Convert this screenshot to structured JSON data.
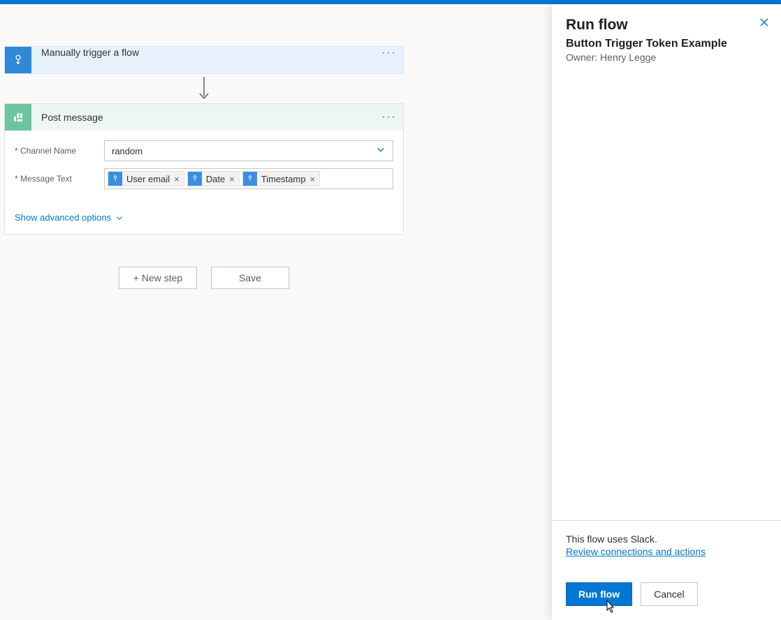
{
  "canvas": {
    "trigger": {
      "title": "Manually trigger a flow"
    },
    "action": {
      "title": "Post message",
      "fields": {
        "channel_label": "* Channel Name",
        "channel_value": "random",
        "message_label": "* Message Text",
        "tokens": [
          {
            "label": "User email"
          },
          {
            "label": "Date"
          },
          {
            "label": "Timestamp"
          }
        ]
      },
      "advanced_label": "Show advanced options"
    },
    "buttons": {
      "new_step": "+ New step",
      "save": "Save"
    }
  },
  "panel": {
    "title": "Run flow",
    "subtitle": "Button Trigger Token Example",
    "owner": "Owner: Henry Legge",
    "footer_text": "This flow uses Slack.",
    "review_link": "Review connections and actions",
    "run_button": "Run flow",
    "cancel_button": "Cancel"
  }
}
